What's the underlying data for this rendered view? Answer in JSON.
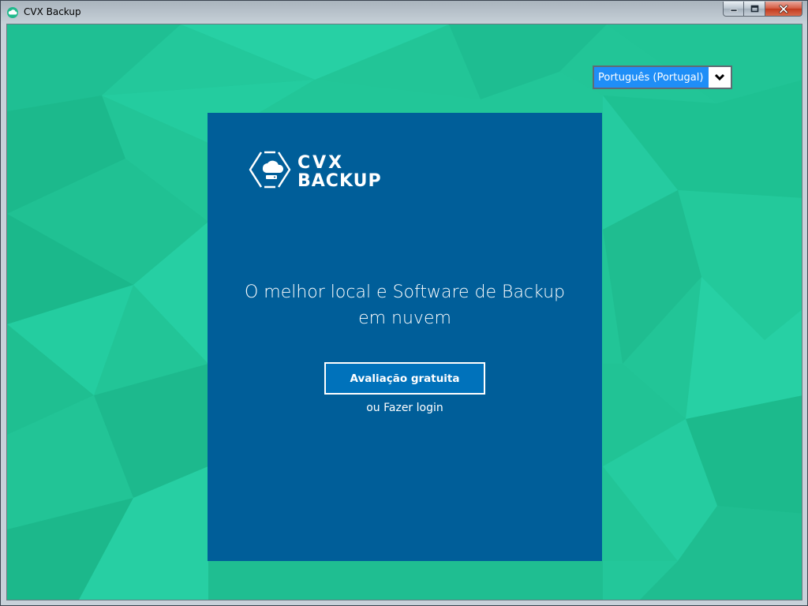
{
  "window": {
    "title": "CVX Backup",
    "controls": [
      "minimize",
      "maximize",
      "close"
    ]
  },
  "language_select": {
    "selected": "Português (Portugal)",
    "icon": "chevron-down-icon"
  },
  "panel": {
    "logo_line1": "CVX",
    "logo_line2": "BACKUP",
    "tagline": "O melhor local e Software de Backup em nuvem",
    "trial_button_label": "Avaliação gratuita",
    "login_link_text": "ou Fazer login"
  },
  "colors": {
    "background_green": "#22c597",
    "panel_blue": "#005e99",
    "button_blue": "#0072bb",
    "select_highlight": "#1f8ef7"
  }
}
